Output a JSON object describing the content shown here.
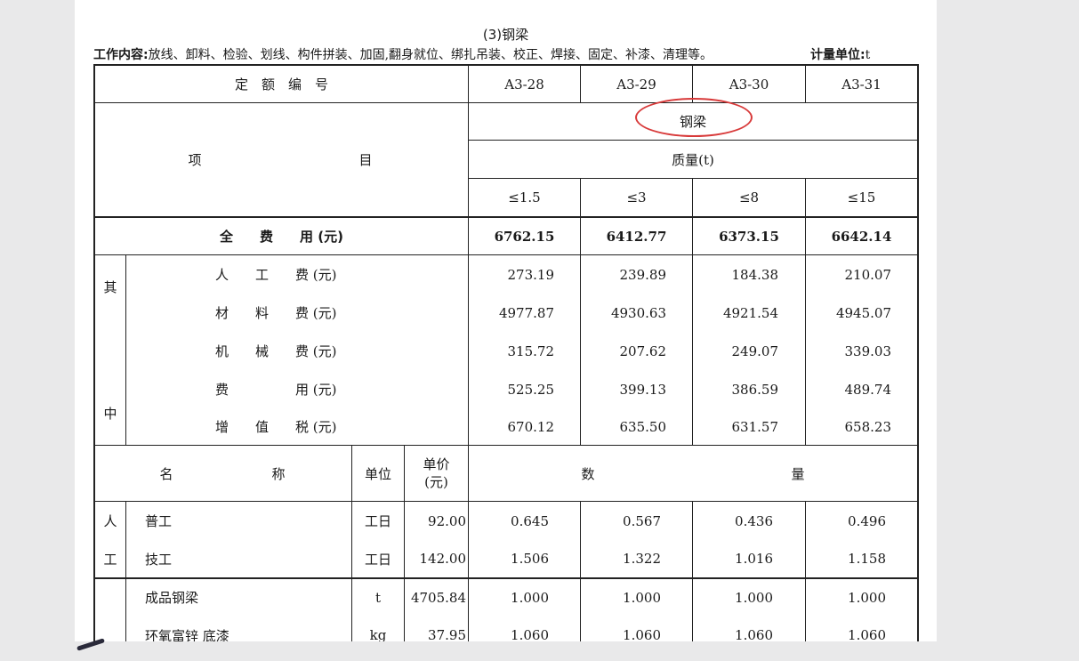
{
  "section_title": "(3)钢梁",
  "work_content": {
    "label": "工作内容:",
    "text": "放线、卸料、检验、划线、构件拼装、加固,翻身就位、绑扎吊装、校正、焊接、固定、补漆、清理等。",
    "unit_label": "计量单位:",
    "unit_value": "t"
  },
  "header": {
    "quota_code_label": "定　额　编　号",
    "codes": [
      "A3-28",
      "A3-29",
      "A3-30",
      "A3-31"
    ],
    "item_label": "项",
    "item_label2": "目",
    "product_name": "钢梁",
    "quantity_label": "质量(t)",
    "ranges": [
      "≤1.5",
      "≤3",
      "≤8",
      "≤15"
    ]
  },
  "total": {
    "label": "全　　费　　用 (元)",
    "values": [
      "6762.15",
      "6412.77",
      "6373.15",
      "6642.14"
    ]
  },
  "breakdown": {
    "side_top": "其",
    "side_bottom": "中",
    "rows": [
      {
        "name": "人　　工　　费 (元)",
        "values": [
          "273.19",
          "239.89",
          "184.38",
          "210.07"
        ]
      },
      {
        "name": "材　　料　　费 (元)",
        "values": [
          "4977.87",
          "4930.63",
          "4921.54",
          "4945.07"
        ]
      },
      {
        "name": "机　　械　　费 (元)",
        "values": [
          "315.72",
          "207.62",
          "249.07",
          "339.03"
        ]
      },
      {
        "name": "费　　　　　用 (元)",
        "values": [
          "525.25",
          "399.13",
          "386.59",
          "489.74"
        ]
      },
      {
        "name": "增　　值　　税 (元)",
        "values": [
          "670.12",
          "635.50",
          "631.57",
          "658.23"
        ]
      }
    ]
  },
  "detail_header": {
    "name_label": "名",
    "name_label2": "称",
    "unit_label": "单位",
    "price_label": "单价",
    "price_label2": "(元)",
    "qty_label": "数",
    "qty_label2": "量"
  },
  "labor": {
    "side_top": "人",
    "side_bottom": "工",
    "rows": [
      {
        "name": "普工",
        "unit": "工日",
        "price": "92.00",
        "values": [
          "0.645",
          "0.567",
          "0.436",
          "0.496"
        ]
      },
      {
        "name": "技工",
        "unit": "工日",
        "price": "142.00",
        "values": [
          "1.506",
          "1.322",
          "1.016",
          "1.158"
        ]
      }
    ]
  },
  "materials": {
    "rows": [
      {
        "name": "成品钢梁",
        "unit": "t",
        "price": "4705.84",
        "values": [
          "1.000",
          "1.000",
          "1.000",
          "1.000"
        ]
      },
      {
        "name": "环氧富锌 底漆",
        "unit": "kg",
        "price": "37.95",
        "values": [
          "1.060",
          "1.060",
          "1.060",
          "1.060"
        ]
      }
    ]
  },
  "colors": {
    "annotation": "#d83a3a",
    "background": "#e9e9ea",
    "page": "#ffffff"
  }
}
